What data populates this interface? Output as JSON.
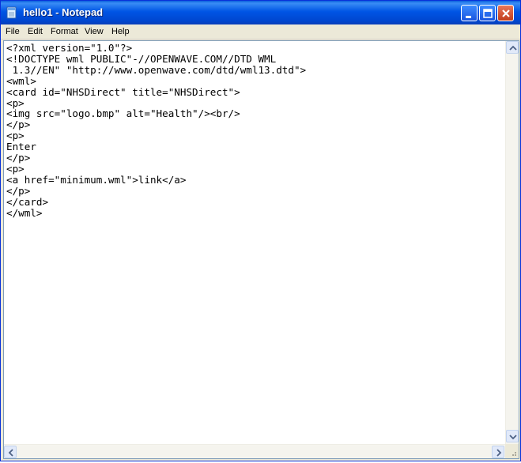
{
  "window": {
    "title": "hello1 - Notepad"
  },
  "menu": [
    "File",
    "Edit",
    "Format",
    "View",
    "Help"
  ],
  "document": {
    "lines": [
      "<?xml version=\"1.0\"?>",
      "<!DOCTYPE wml PUBLIC\"-//OPENWAVE.COM//DTD WML",
      " 1.3//EN\" \"http://www.openwave.com/dtd/wml13.dtd\">",
      "<wml>",
      "<card id=\"NHSDirect\" title=\"NHSDirect\">",
      "<p>",
      "<img src=\"logo.bmp\" alt=\"Health\"/><br/>",
      "</p>",
      "<p>",
      "Enter",
      "</p>",
      "<p>",
      "<a href=\"minimum.wml\">link</a>",
      "</p>",
      "</card>",
      "</wml>"
    ]
  },
  "icons": {
    "app": "notepad-icon",
    "minimize": "minimize-icon",
    "maximize": "maximize-icon",
    "close": "close-icon"
  },
  "colors": {
    "titlebar": "#0055e5",
    "close_button": "#c23d1b"
  }
}
